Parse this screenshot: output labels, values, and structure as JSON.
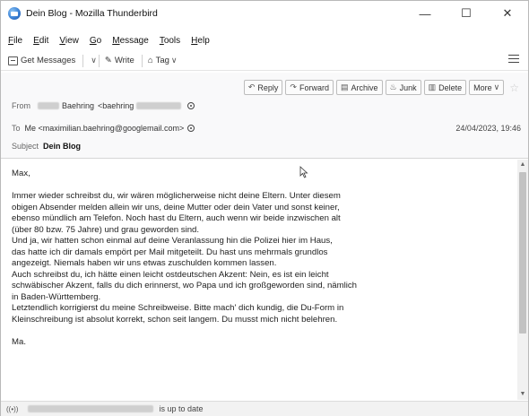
{
  "window": {
    "title": "Dein Blog - Mozilla Thunderbird",
    "controls": {
      "minimize": "—",
      "maximize": "☐",
      "close": "✕"
    }
  },
  "menu": {
    "items": [
      {
        "accel": "F",
        "rest": "ile"
      },
      {
        "accel": "E",
        "rest": "dit"
      },
      {
        "accel": "V",
        "rest": "iew"
      },
      {
        "accel": "G",
        "rest": "o"
      },
      {
        "accel": "M",
        "rest": "essage"
      },
      {
        "accel": "T",
        "rest": "ools"
      },
      {
        "accel": "H",
        "rest": "elp"
      }
    ]
  },
  "toolbar": {
    "get_messages": "Get Messages",
    "write": "Write",
    "tag": "Tag"
  },
  "header": {
    "actions": {
      "reply": "Reply",
      "forward": "Forward",
      "archive": "Archive",
      "junk": "Junk",
      "delete": "Delete",
      "more": "More"
    },
    "from_label": "From",
    "from_name": "Baehring",
    "from_email_prefix": "<baehring",
    "to_label": "To",
    "to_value": "Me <maximilian.baehring@googlemail.com>",
    "date": "24/04/2023, 19:46",
    "subject_label": "Subject",
    "subject": "Dein Blog"
  },
  "message": {
    "body": "Max,\n\nImmer wieder schreibst du, wir wären möglicherweise nicht deine Eltern. Unter diesem\nobigen Absender melden allein wir uns, deine Mutter oder dein Vater und sonst keiner,\nebenso mündlich am Telefon. Noch hast du Eltern, auch wenn wir beide inzwischen alt\n(über 80 bzw. 75 Jahre) und grau geworden sind.\nUnd ja, wir hatten schon einmal auf deine Veranlassung hin die Polizei hier im Haus,\ndas hatte ich dir damals empört per Mail mitgeteilt. Du hast uns mehrmals grundlos\nangezeigt. Niemals haben wir uns etwas zuschulden kommen lassen.\nAuch schreibst du, ich hätte einen leicht ostdeutschen Akzent: Nein, es ist ein leicht\nschwäbischer Akzent, falls du dich erinnerst, wo Papa und ich großgeworden sind, nämlich\nin Baden-Württemberg.\nLetztendlich korrigierst du meine Schreibweise. Bitte mach' dich kundig, die Du-Form in\nKleinschreibung ist absolut korrekt, schon seit langem. Du musst mich nicht belehren.\n\nMa."
  },
  "status": {
    "text": "is up to date"
  }
}
